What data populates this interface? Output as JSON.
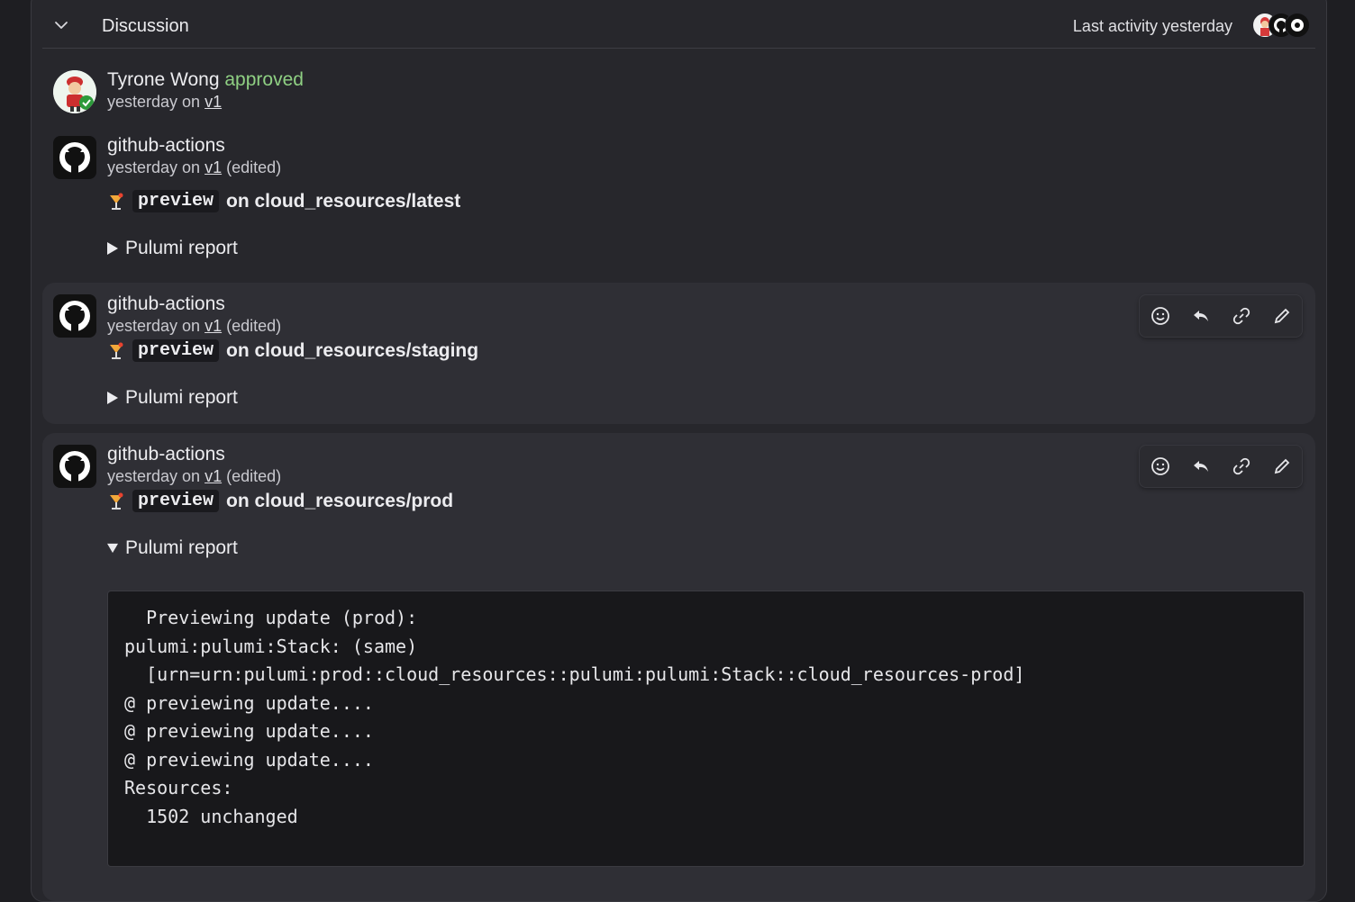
{
  "discussion": {
    "title": "Discussion",
    "last_activity": "Last activity yesterday",
    "participant_avatars": [
      "tyrone-wong-avatar",
      "github-icon",
      "bot-icon"
    ]
  },
  "comments": [
    {
      "author": "Tyrone Wong",
      "action": "approved",
      "time": "yesterday on",
      "version": "v1",
      "edited": ""
    },
    {
      "author": "github-actions",
      "time": "yesterday on",
      "version": "v1",
      "edited": "(edited)",
      "command": "preview",
      "target": "on cloud_resources/latest",
      "details_label": "Pulumi report",
      "expanded": false
    },
    {
      "author": "github-actions",
      "time": "yesterday on",
      "version": "v1",
      "edited": "(edited)",
      "command": "preview",
      "target": "on cloud_resources/staging",
      "details_label": "Pulumi report",
      "expanded": false
    },
    {
      "author": "github-actions",
      "time": "yesterday on",
      "version": "v1",
      "edited": "(edited)",
      "command": "preview",
      "target": "on cloud_resources/prod",
      "details_label": "Pulumi report",
      "expanded": true,
      "report": "  Previewing update (prod):\npulumi:pulumi:Stack: (same)\n  [urn=urn:pulumi:prod::cloud_resources::pulumi:pulumi:Stack::cloud_resources-prod]\n@ previewing update....\n@ previewing update....\n@ previewing update....\nResources:\n  1502 unchanged"
    }
  ],
  "toolbar_icons": [
    "emoji-icon",
    "reply-icon",
    "link-icon",
    "edit-icon"
  ],
  "colors": {
    "approved": "#8fd083",
    "background": "#1e1e22",
    "panel": "#27272c"
  }
}
